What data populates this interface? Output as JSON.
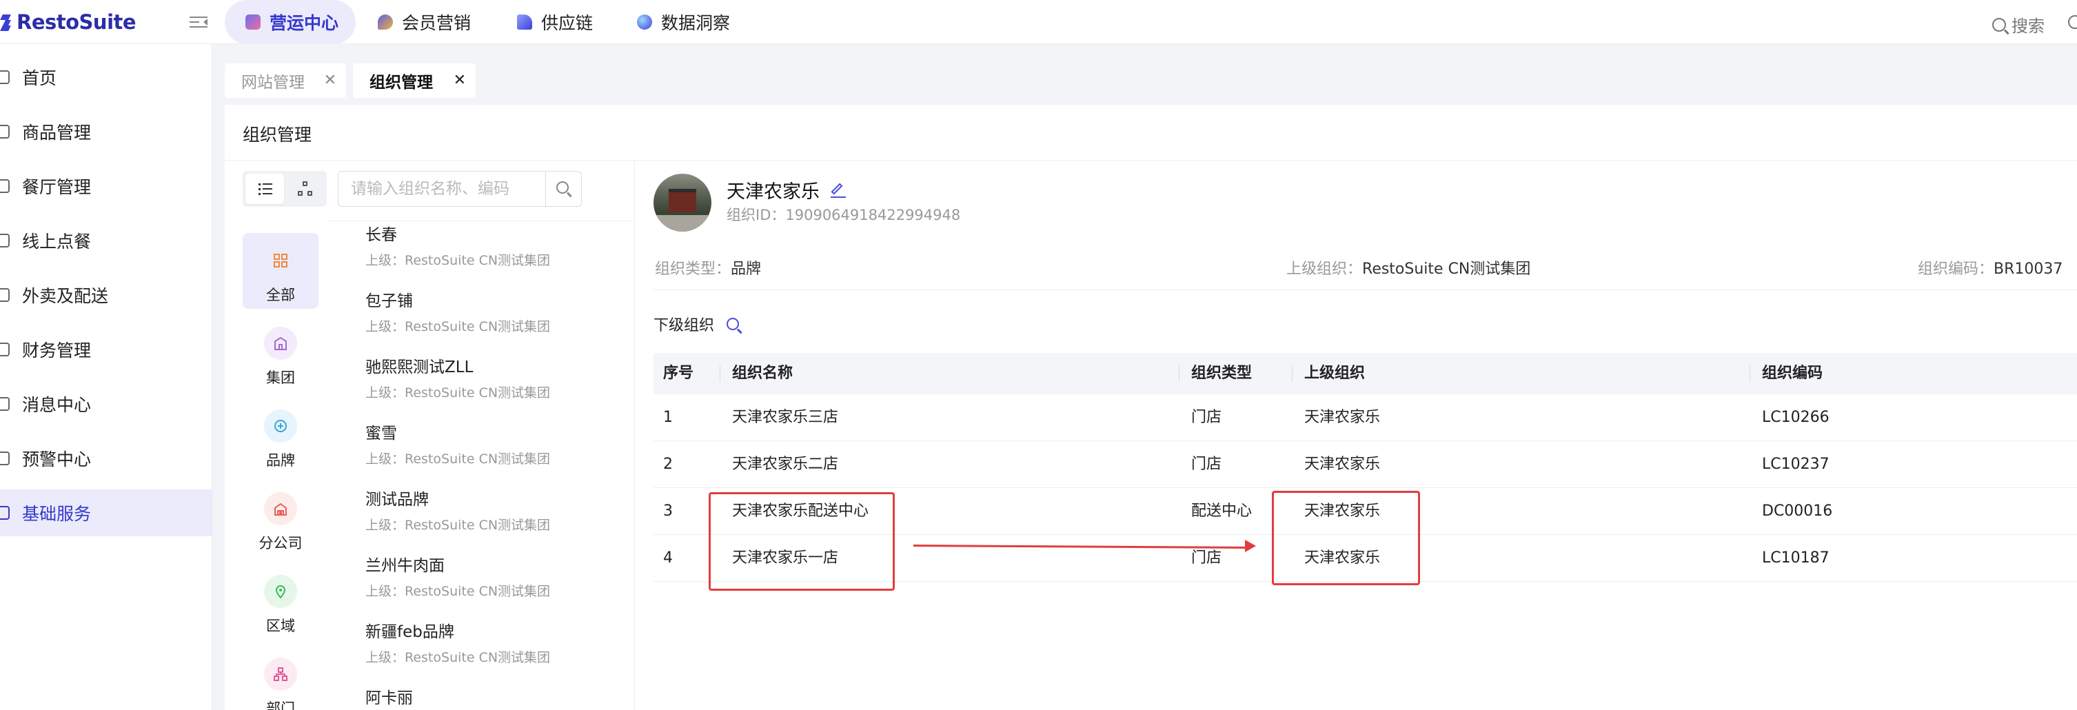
{
  "app": {
    "logo_text": "RestoSuite",
    "search_label": "搜索"
  },
  "colors": {
    "accent": "#3538cd",
    "highlight": "#e23d3d"
  },
  "top_nav": [
    {
      "label": "营运中心",
      "active": true,
      "icon": "ops-icon"
    },
    {
      "label": "会员营销",
      "active": false,
      "icon": "member-icon"
    },
    {
      "label": "供应链",
      "active": false,
      "icon": "supply-icon"
    },
    {
      "label": "数据洞察",
      "active": false,
      "icon": "data-icon"
    }
  ],
  "sidebar": {
    "items": [
      {
        "label": "首页"
      },
      {
        "label": "商品管理"
      },
      {
        "label": "餐厅管理"
      },
      {
        "label": "线上点餐"
      },
      {
        "label": "外卖及配送"
      },
      {
        "label": "财务管理"
      },
      {
        "label": "消息中心"
      },
      {
        "label": "预警中心"
      },
      {
        "label": "基础服务",
        "active": true
      }
    ]
  },
  "page_tabs": [
    {
      "label": "网站管理",
      "active": false
    },
    {
      "label": "组织管理",
      "active": true
    }
  ],
  "panel": {
    "title": "组织管理",
    "tree_search_placeholder": "请输入组织名称、编码",
    "types": [
      {
        "label": "全部",
        "active": true
      },
      {
        "label": "集团"
      },
      {
        "label": "品牌"
      },
      {
        "label": "分公司"
      },
      {
        "label": "区域"
      },
      {
        "label": "部门"
      }
    ],
    "orgs": [
      {
        "name": "长春",
        "parent": "上级：RestoSuite CN测试集团"
      },
      {
        "name": "包子铺",
        "parent": "上级：RestoSuite CN测试集团"
      },
      {
        "name": "驰熙熙测试ZLL",
        "parent": "上级：RestoSuite CN测试集团"
      },
      {
        "name": "蜜雪",
        "parent": "上级：RestoSuite CN测试集团"
      },
      {
        "name": "测试品牌",
        "parent": "上级：RestoSuite CN测试集团"
      },
      {
        "name": "兰州牛肉面",
        "parent": "上级：RestoSuite CN测试集团"
      },
      {
        "name": "新疆feb品牌",
        "parent": "上级：RestoSuite CN测试集团"
      },
      {
        "name": "阿卡丽",
        "parent": ""
      }
    ]
  },
  "detail": {
    "name": "天津农家乐",
    "id_label": "组织ID：",
    "id_value": "1909064918422994948",
    "type_label": "组织类型：",
    "type_value": "品牌",
    "parent_label": "上级组织：",
    "parent_value": "RestoSuite CN测试集团",
    "code_label": "组织编码：",
    "code_value": "BR10037",
    "sub_title": "下级组织",
    "columns": [
      "序号",
      "组织名称",
      "组织类型",
      "上级组织",
      "组织编码"
    ],
    "rows": [
      [
        "1",
        "天津农家乐三店",
        "门店",
        "天津农家乐",
        "LC10266"
      ],
      [
        "2",
        "天津农家乐二店",
        "门店",
        "天津农家乐",
        "LC10237"
      ],
      [
        "3",
        "天津农家乐配送中心",
        "配送中心",
        "天津农家乐",
        "DC00016"
      ],
      [
        "4",
        "天津农家乐一店",
        "门店",
        "天津农家乐",
        "LC10187"
      ]
    ]
  }
}
